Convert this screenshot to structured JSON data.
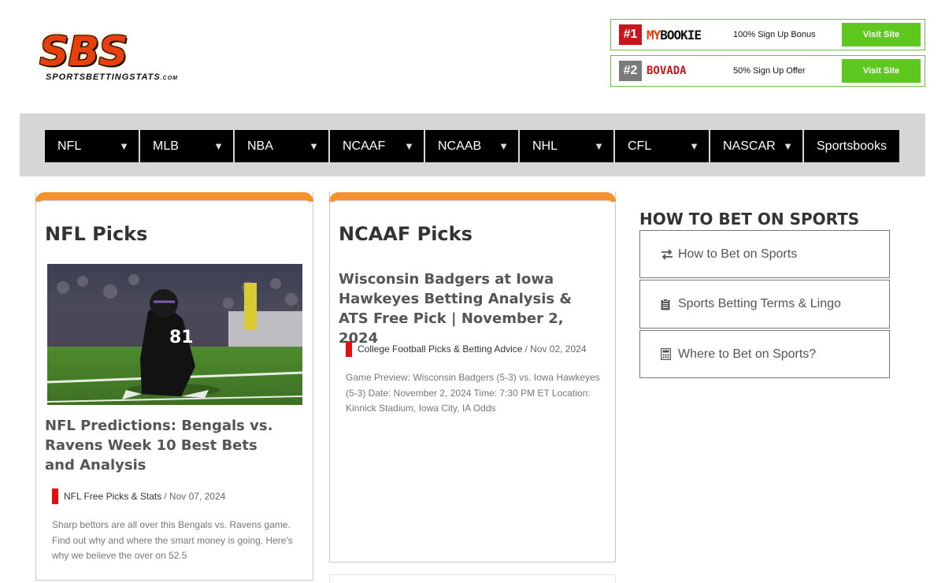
{
  "logo": {
    "letters": "SBS",
    "subtitle": "SPORTSBETTINGSTATS",
    "subtitle_suffix": ".COM"
  },
  "ads": [
    {
      "rank": "#1",
      "brand_a": "MY",
      "brand_b": "BOOKIE",
      "offer": "100% Sign Up Bonus",
      "button": "Visit Site"
    },
    {
      "rank": "#2",
      "brand_a": "BOVADA",
      "brand_b": "",
      "offer": "50% Sign Up Offer",
      "button": "Visit Site"
    }
  ],
  "nav": [
    {
      "label": "NFL",
      "width": 119
    },
    {
      "label": "MLB",
      "width": 118
    },
    {
      "label": "NBA",
      "width": 119
    },
    {
      "label": "NCAAF",
      "width": 119
    },
    {
      "label": "NCAAB",
      "width": 118
    },
    {
      "label": "NHL",
      "width": 119
    },
    {
      "label": "CFL",
      "width": 119
    },
    {
      "label": "NASCAR",
      "width": 117
    },
    {
      "label": "Sportsbooks",
      "width": 0
    }
  ],
  "cards": [
    {
      "title": "NFL Picks",
      "post_title": "NFL Predictions: Bengals vs. Ravens Week 10 Best Bets and Analysis",
      "category": "NFL Free Picks & Stats",
      "date": "/ Nov 07, 2024",
      "excerpt": "Sharp bettors are all over this Bengals vs. Ravens game. Find out why and where the smart money is going. Here's why we believe the over on 52.5"
    },
    {
      "title": "NCAAF Picks",
      "post_title": "Wisconsin Badgers at Iowa Hawkeyes Betting Analysis & ATS Free Pick | November 2, 2024",
      "category": "College Football Picks & Betting Advice",
      "date": "/ Nov 02, 2024",
      "excerpt": "Game Preview: Wisconsin Badgers (5-3) vs. Iowa Hawkeyes (5-3) Date: November 2, 2024 Time: 7:30 PM ET Location: Kinnick Stadium, Iowa City, IA Odds"
    }
  ],
  "sidebar": {
    "title": "HOW TO BET ON SPORTS",
    "links": [
      {
        "label": "How to Bet on Sports",
        "icon": "exchange-icon"
      },
      {
        "label": "Sports Betting Terms & Lingo",
        "icon": "clipboard-icon"
      },
      {
        "label": "Where to Bet on Sports?",
        "icon": "calculator-icon"
      }
    ]
  },
  "colors": {
    "accent": "#f5922e",
    "nav_bg": "#000000",
    "cta": "#5ec81e",
    "category_bar": "#e60d0d"
  }
}
